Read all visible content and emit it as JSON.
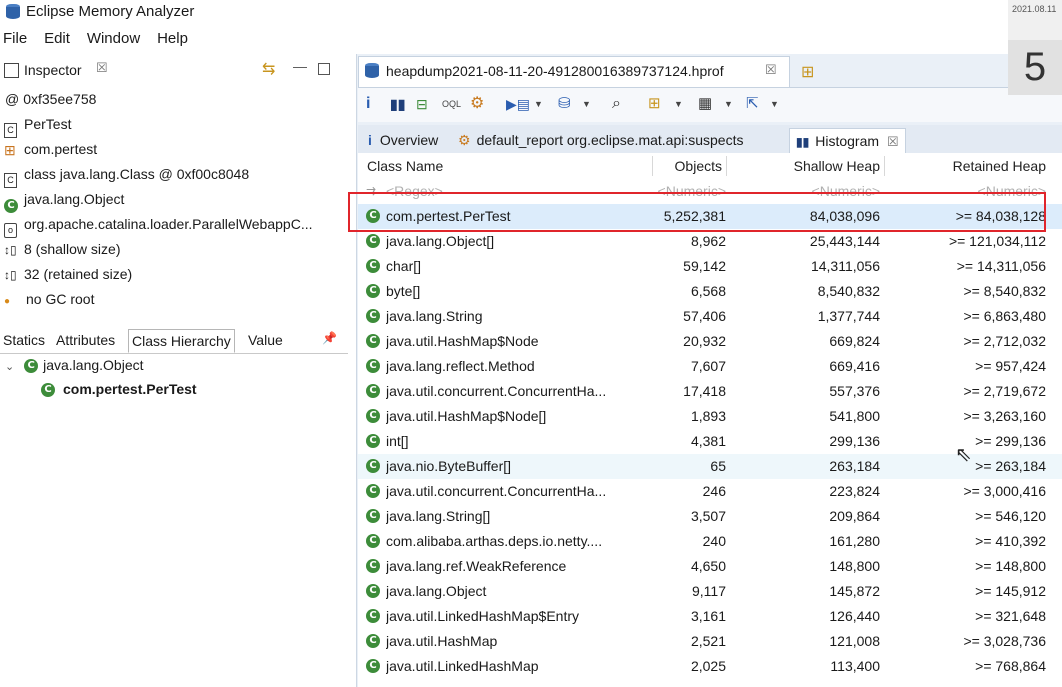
{
  "app": {
    "title": "Eclipse Memory Analyzer"
  },
  "menu": [
    "File",
    "Edit",
    "Window",
    "Help"
  ],
  "inspector": {
    "title": "Inspector",
    "rows": [
      {
        "icon": "at-icon",
        "text": "0xf35ee758"
      },
      {
        "icon": "class-file-icon",
        "text": "PerTest"
      },
      {
        "icon": "package-icon",
        "text": "com.pertest"
      },
      {
        "icon": "class-file-icon",
        "text": "class java.lang.Class @ 0xf00c8048"
      },
      {
        "icon": "class-green-icon",
        "text": "java.lang.Object"
      },
      {
        "icon": "classloader-icon",
        "text": "org.apache.catalina.loader.ParallelWebappC..."
      },
      {
        "icon": "size-icon",
        "text": "8 (shallow size)"
      },
      {
        "icon": "size-icon",
        "text": "32 (retained size)"
      },
      {
        "icon": "dot-icon",
        "text": "no GC root"
      }
    ],
    "tabs": [
      "Statics",
      "Attributes",
      "Class Hierarchy",
      "Value"
    ],
    "active_tab": "Class Hierarchy",
    "hierarchy": [
      "java.lang.Object",
      "com.pertest.PerTest"
    ]
  },
  "editor": {
    "file_tab": "heapdump2021-08-11-20-491280016389737124.hprof",
    "subtabs": [
      {
        "label": "Overview"
      },
      {
        "label": "default_report  org.eclipse.mat.api:suspects"
      },
      {
        "label": "Histogram"
      }
    ]
  },
  "histogram": {
    "columns": [
      "Class Name",
      "Objects",
      "Shallow Heap",
      "Retained Heap"
    ],
    "filter": [
      "<Regex>",
      "<Numeric>",
      "<Numeric>",
      "<Numeric>"
    ],
    "rows": [
      {
        "name": "com.pertest.PerTest",
        "objects": "5,252,381",
        "shallow": "84,038,096",
        "retained": ">= 84,038,128"
      },
      {
        "name": "java.lang.Object[]",
        "objects": "8,962",
        "shallow": "25,443,144",
        "retained": ">= 121,034,112"
      },
      {
        "name": "char[]",
        "objects": "59,142",
        "shallow": "14,311,056",
        "retained": ">= 14,311,056"
      },
      {
        "name": "byte[]",
        "objects": "6,568",
        "shallow": "8,540,832",
        "retained": ">= 8,540,832"
      },
      {
        "name": "java.lang.String",
        "objects": "57,406",
        "shallow": "1,377,744",
        "retained": ">= 6,863,480"
      },
      {
        "name": "java.util.HashMap$Node",
        "objects": "20,932",
        "shallow": "669,824",
        "retained": ">= 2,712,032"
      },
      {
        "name": "java.lang.reflect.Method",
        "objects": "7,607",
        "shallow": "669,416",
        "retained": ">= 957,424"
      },
      {
        "name": "java.util.concurrent.ConcurrentHa...",
        "objects": "17,418",
        "shallow": "557,376",
        "retained": ">= 2,719,672"
      },
      {
        "name": "java.util.HashMap$Node[]",
        "objects": "1,893",
        "shallow": "541,800",
        "retained": ">= 3,263,160"
      },
      {
        "name": "int[]",
        "objects": "4,381",
        "shallow": "299,136",
        "retained": ">= 299,136"
      },
      {
        "name": "java.nio.ByteBuffer[]",
        "objects": "65",
        "shallow": "263,184",
        "retained": ">= 263,184"
      },
      {
        "name": "java.util.concurrent.ConcurrentHa...",
        "objects": "246",
        "shallow": "223,824",
        "retained": ">= 3,000,416"
      },
      {
        "name": "java.lang.String[]",
        "objects": "3,507",
        "shallow": "209,864",
        "retained": ">= 546,120"
      },
      {
        "name": "com.alibaba.arthas.deps.io.netty....",
        "objects": "240",
        "shallow": "161,280",
        "retained": ">= 410,392"
      },
      {
        "name": "java.lang.ref.WeakReference",
        "objects": "4,650",
        "shallow": "148,800",
        "retained": ">= 148,800"
      },
      {
        "name": "java.lang.Object",
        "objects": "9,117",
        "shallow": "145,872",
        "retained": ">= 145,912"
      },
      {
        "name": "java.util.LinkedHashMap$Entry",
        "objects": "3,161",
        "shallow": "126,440",
        "retained": ">= 321,648"
      },
      {
        "name": "java.util.HashMap",
        "objects": "2,521",
        "shallow": "121,008",
        "retained": ">= 3,028,736"
      },
      {
        "name": "java.util.LinkedHashMap",
        "objects": "2,025",
        "shallow": "113,400",
        "retained": ">= 768,864"
      }
    ]
  },
  "clock": {
    "date": "2021.08.11",
    "digit": "5"
  },
  "colors": {
    "accent": "#3d8c3a",
    "highlight": "#e0252b",
    "selection": "#dcecfb"
  }
}
